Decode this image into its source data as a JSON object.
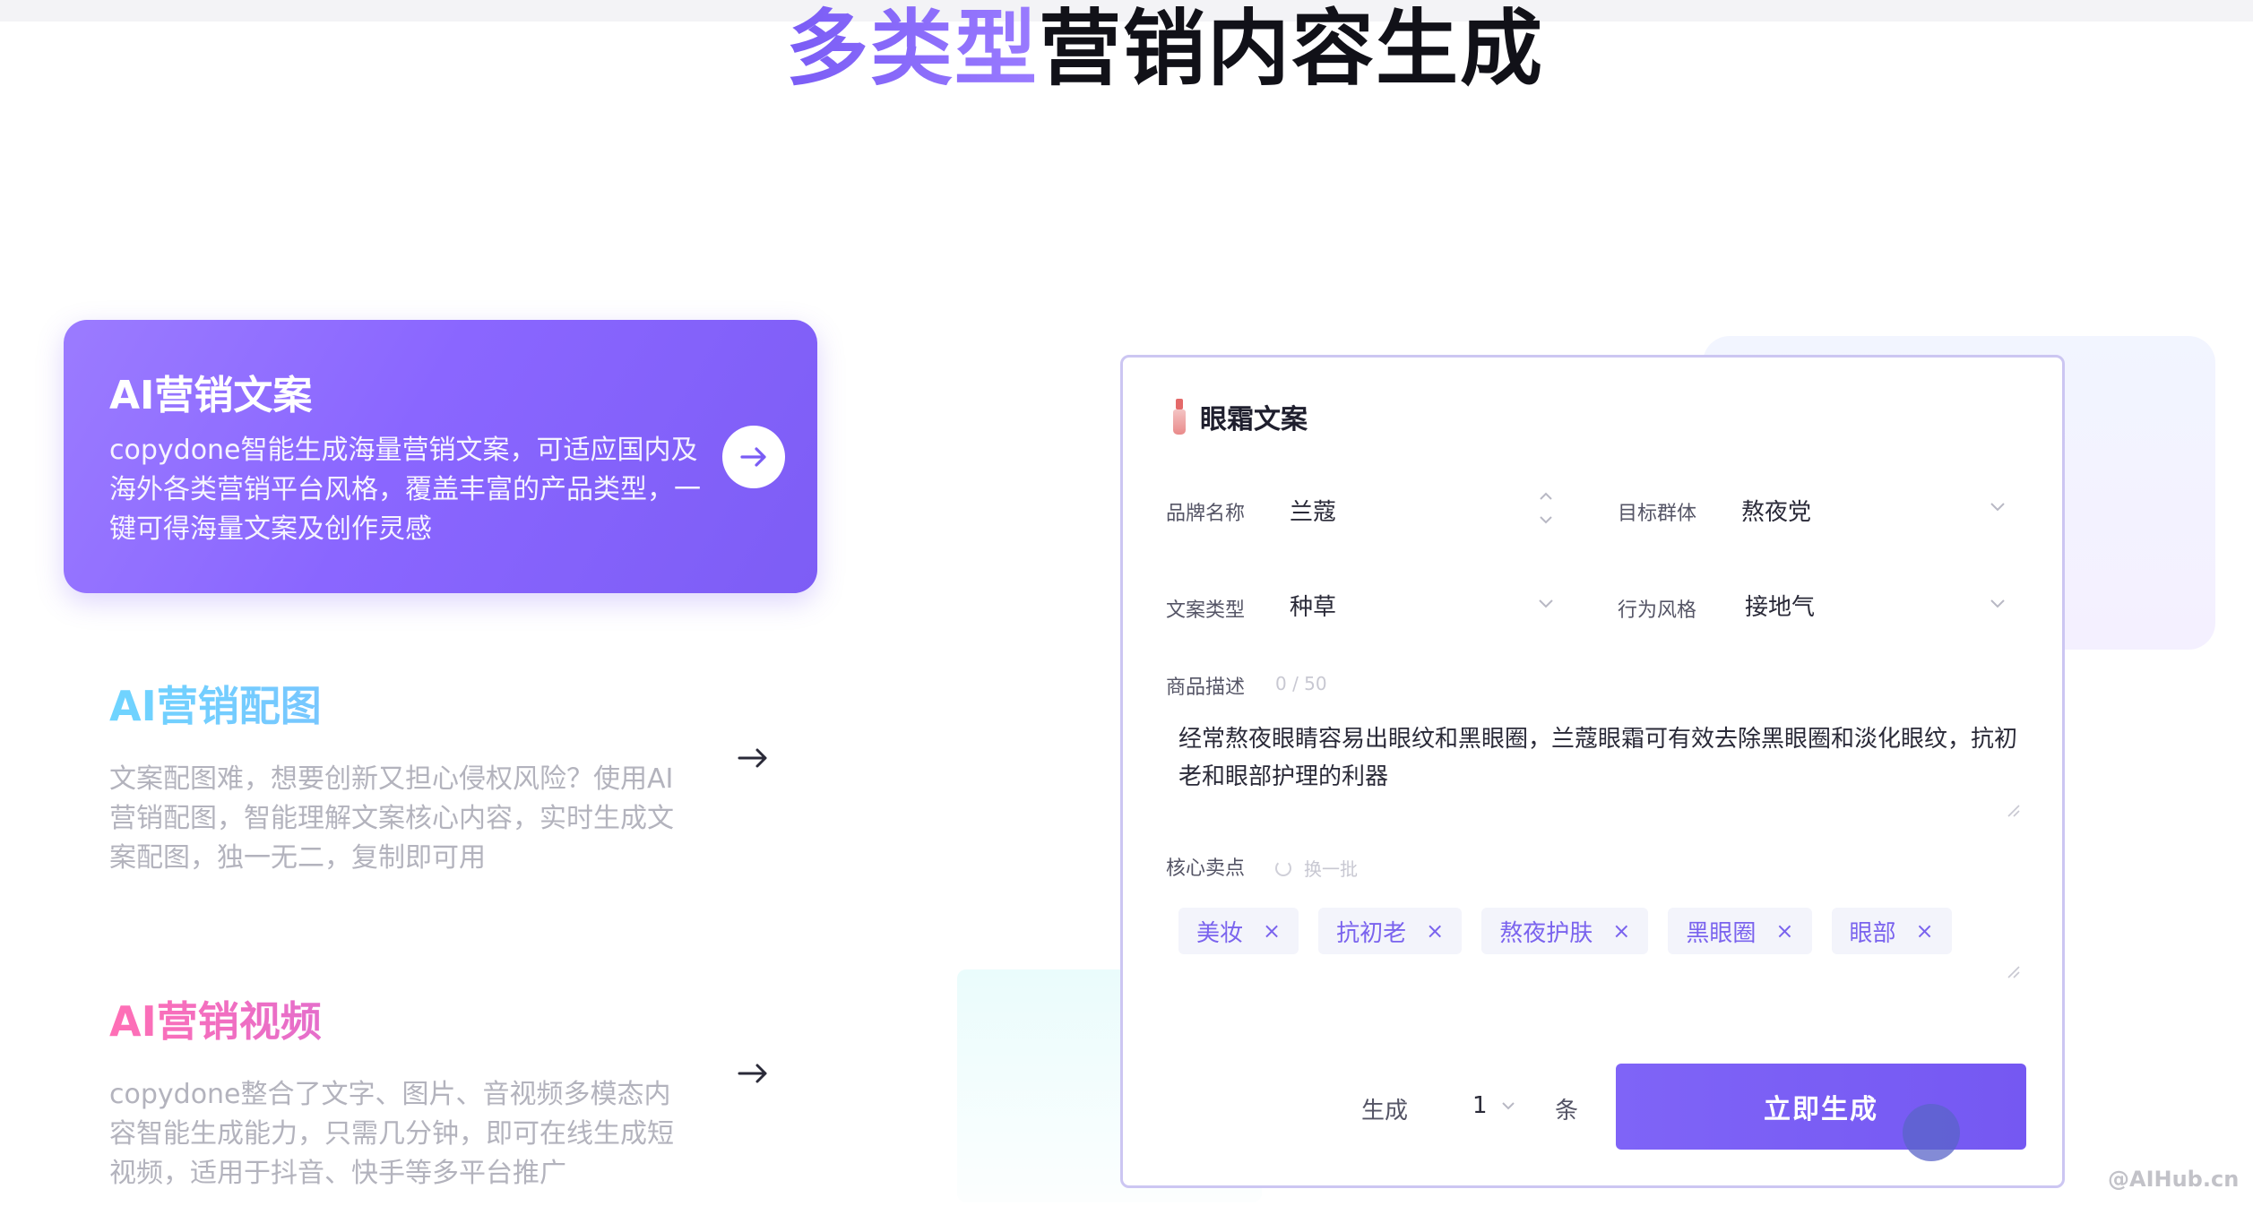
{
  "page": {
    "title_accent": "多类型",
    "title_rest": "营销内容生成"
  },
  "features": [
    {
      "title": "AI营销文案",
      "desc": "copydone智能生成海量营销文案，可适应国内及海外各类营销平台风格，覆盖丰富的产品类型，一键可得海量文案及创作灵感",
      "arrow_icon": "arrow-right-icon"
    },
    {
      "title": "AI营销配图",
      "desc": "文案配图难，想要创新又担心侵权风险？使用AI营销配图，智能理解文案核心内容，实时生成文案配图，独一无二，复制即可用",
      "arrow_icon": "arrow-right-icon"
    },
    {
      "title": "AI营销视频",
      "desc": "copydone整合了文字、图片、音视频多模态内容智能生成能力，只需几分钟，即可在线生成短视频，适用于抖音、快手等多平台推广",
      "arrow_icon": "arrow-right-icon"
    }
  ],
  "panel": {
    "title": "眼霜文案",
    "fields": {
      "brand_label": "品牌名称",
      "brand_value": "兰蔻",
      "audience_label": "目标群体",
      "audience_value": "熬夜党",
      "type_label": "文案类型",
      "type_value": "种草",
      "style_label": "行为风格",
      "style_value": "接地气"
    },
    "desc_label": "商品描述",
    "desc_counter": "0 / 50",
    "desc_text": "经常熬夜眼睛容易出眼纹和黑眼圈，兰蔻眼霜可有效去除黑眼圈和淡化眼纹，抗初老和眼部护理的利器",
    "selling_label": "核心卖点",
    "refresh_label": "换一批",
    "tags": [
      "美妆",
      "抗初老",
      "熬夜护肤",
      "黑眼圈",
      "眼部"
    ],
    "tag_close": "×",
    "generate_prefix": "生成",
    "generate_count": "1",
    "generate_suffix": "条",
    "generate_button": "立即生成"
  },
  "watermark": "@AIHub.cn",
  "colors": {
    "accent": "#7a5cf5",
    "panel_border": "#ccc6f2",
    "tag_text": "#7a63ee",
    "button": "#7558f2"
  }
}
